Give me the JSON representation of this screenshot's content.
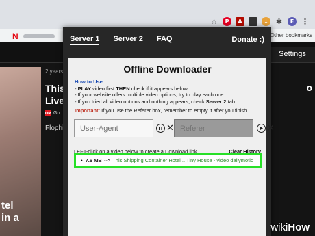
{
  "bookmarks": {
    "netflix_letter": "N",
    "other_bookmarks": "Other bookmarks"
  },
  "page": {
    "settings_label": "Settings",
    "meta": "2 years a",
    "title_left_line1": "This",
    "title_left_line2": "Live",
    "source_badge": "OM",
    "source_name": "Go",
    "byline": "Flophi",
    "title_right": "o",
    "photo_line1": "tel",
    "photo_line2": "in a"
  },
  "popup": {
    "tabs": [
      "Server 1",
      "Server 2",
      "FAQ"
    ],
    "donate": "Donate :)",
    "title": "Offline Downloader",
    "howto_header": "How to Use:",
    "howto_line1_a": "- ",
    "howto_line1_play": "PLAY",
    "howto_line1_b": " video first ",
    "howto_line1_then": "THEN",
    "howto_line1_c": " check if it appears below.",
    "howto_line2": "- If your website offers multiple video options, try to play each one.",
    "howto_line3_a": "- If you tried all video options and nothing appears, check ",
    "howto_line3_server": "Server 2",
    "howto_line3_b": " tab.",
    "important_header": "Important:",
    "important_text": " If you use the Referer box, remember to empty it after you finish.",
    "user_agent_placeholder": "User-Agent",
    "referer_placeholder": "Referer",
    "list_instruction": "LEFT-click on a video below to create a Download link",
    "clear_history": "Clear History",
    "video": {
      "bullet": "•",
      "size": "7.6 MB",
      "arrow": "-->",
      "name": "This Shipping Container Hotel .. Tiny House - video dailymotio"
    }
  },
  "watermark": {
    "prefix": "wiki",
    "suffix": "How"
  },
  "colors": {
    "highlight": "#27e027",
    "howto": "#1a4bb3",
    "important": "#c0392b",
    "netflix": "#e50914"
  },
  "icons": [
    "star-icon",
    "pinterest-icon",
    "pdf-icon",
    "screen-icon",
    "download-ext-icon",
    "puzzle-icon",
    "profile-avatar",
    "menu-icon",
    "pause-circle-icon",
    "play-circle-icon",
    "close-icon"
  ]
}
